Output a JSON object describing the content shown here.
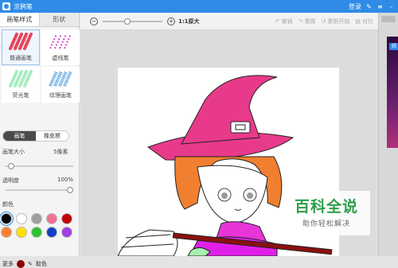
{
  "app": {
    "title": "涂鸦笔",
    "login": "登录"
  },
  "left_panel": {
    "tabs": [
      {
        "label": "画笔样式"
      },
      {
        "label": "形状"
      }
    ],
    "brushes": [
      {
        "label": "普通画笔",
        "color": "#e8455a"
      },
      {
        "label": "虚线笔",
        "color": "#d44bd1"
      },
      {
        "label": "荧光笔",
        "color": "#7fe0a0"
      },
      {
        "label": "纹理画笔",
        "color": "#3b8fd8"
      }
    ],
    "mode_toggle": {
      "options": [
        "画笔",
        "橡皮擦"
      ],
      "selected": "画笔"
    },
    "size": {
      "label": "画笔大小",
      "value": "5像素",
      "level": 0.05
    },
    "opacity": {
      "label": "透明度",
      "value": "100%",
      "level": 1.0
    },
    "color_label": "颜色",
    "swatches": [
      "#000000",
      "#ffffff",
      "#9e9e9e",
      "#f07090",
      "#c00000",
      "#ff8030",
      "#ffe000",
      "#30c030",
      "#1040c0",
      "#a040e0"
    ],
    "selected_swatch": "#000000",
    "bottom": {
      "more": "更多",
      "current_color": "#8a0000",
      "picker": "取色"
    }
  },
  "toolbar": {
    "zoom_out": "−",
    "zoom_in": "+",
    "zoom_label": "1:1原大",
    "zoom_level": 0.4,
    "undo": "撤销",
    "redo": "重做",
    "reset": "重新开始",
    "compare": "对比"
  },
  "right_strip": {
    "badge": "综"
  },
  "watermark": {
    "title": "百科全说",
    "subtitle": "助你轻松解决"
  }
}
